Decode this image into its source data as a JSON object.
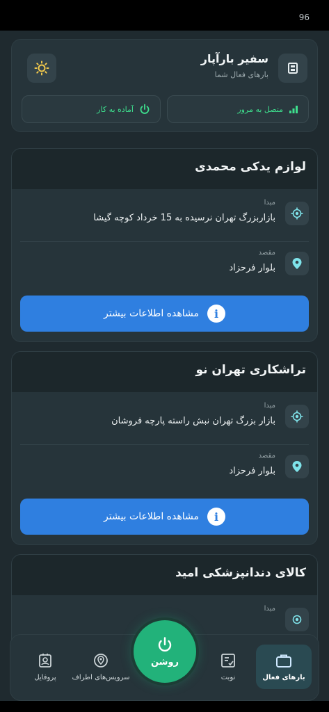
{
  "status": {
    "battery": "96"
  },
  "header": {
    "title": "سفیر بارآپار",
    "subtitle": "بارهای فعال شما",
    "stats": [
      {
        "label": "متصل به مرور",
        "icon": "signal-icon"
      },
      {
        "label": "آماده به کار",
        "icon": "power-icon"
      }
    ]
  },
  "cargos": [
    {
      "title": "لوازم یدکی محمدی",
      "origin_label": "مبدا",
      "origin": "بازاربزرگ تهران نرسیده به 15 خرداد کوچه گیشا",
      "destination_label": "مقصد",
      "destination": "بلوار فرحزاد",
      "button": "مشاهده اطلاعات بیشتر"
    },
    {
      "title": "تراشکاری تهران نو",
      "origin_label": "مبدا",
      "origin": "بازار بزرگ تهران نبش راسته پارچه فروشان",
      "destination_label": "مقصد",
      "destination": "بلوار فرحزاد",
      "button": "مشاهده اطلاعات بیشتر"
    },
    {
      "title": "کالای دندانپزشکی امید",
      "origin_label": "مبدا"
    }
  ],
  "nav": {
    "active_loads": "بارهای فعال",
    "turn": "نوبت",
    "nearby": "سرویس‌های اطراف",
    "profile": "پروفایل",
    "power": "روشن"
  },
  "colors": {
    "background": "#1f2a2f",
    "card": "#26343a",
    "accent_green": "#3ee08e",
    "button_blue": "#2f7fe0",
    "power_green": "#22b27a"
  }
}
